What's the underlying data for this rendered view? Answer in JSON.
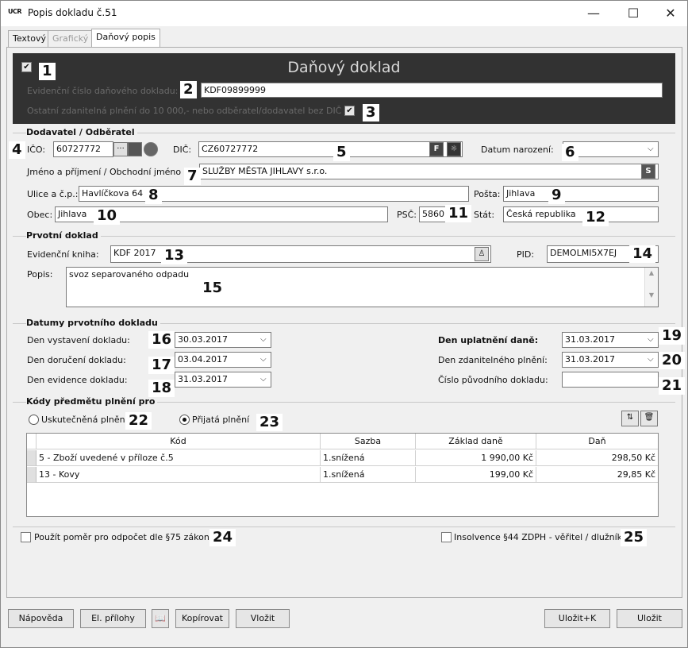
{
  "window": {
    "icon_text": "UCR",
    "title": "Popis dokladu č.51",
    "min": "—",
    "max": "☐",
    "close": "✕"
  },
  "tabs": [
    "Textový",
    "Grafický",
    "Daňový popis"
  ],
  "header": {
    "title": "Daňový doklad",
    "evid_label": "Evidenční číslo daňového dokladu:",
    "evid_value": "KDF09899999",
    "other_label": "Ostatní zdanitelná plnění do 10 000,- nebo odběratel/dodavatel bez DIČ",
    "check1": "✔",
    "check3": "✔"
  },
  "supplier": {
    "section": "Dodavatel / Odběratel",
    "ico_label": "IČO:",
    "ico_value": "60727772",
    "dic_label": "DIČ:",
    "dic_value": "CZ60727772",
    "birth_label": "Datum narození:",
    "birth_value": "",
    "name_label": "Jméno a příjmení / Obchodní jméno",
    "name_value": "SLUŽBY MĚSTA JIHLAVY s.r.o.",
    "street_label": "Ulice a č.p.:",
    "street_value": "Havlíčkova 64",
    "post_label": "Pošta:",
    "post_value": "Jihlava",
    "city_label": "Obec:",
    "city_value": "Jihlava",
    "psc_label": "PSČ:",
    "psc_value": "58601",
    "state_label": "Stát:",
    "state_value": "Česká republika",
    "dots": "···"
  },
  "primary": {
    "section": "Prvotní doklad",
    "book_label": "Evidenční kniha:",
    "book_value": "KDF 2017",
    "pid_label": "PID:",
    "pid_value": "DEMOLMI5X7EJ",
    "desc_label": "Popis:",
    "desc_value": "svoz separovaného odpadu"
  },
  "dates": {
    "section": "Datumy prvotního dokladu",
    "issue_label": "Den vystavení dokladu:",
    "issue_value": "30.03.2017",
    "delivery_label": "Den doručení dokladu:",
    "delivery_value": "03.04.2017",
    "record_label": "Den evidence dokladu:",
    "record_value": "31.03.2017",
    "tax_label": "Den uplatnění daně:",
    "tax_value": "31.03.2017",
    "taxable_label": "Den zdanitelného plnění:",
    "taxable_value": "31.03.2017",
    "orig_label": "Číslo původního dokladu:",
    "orig_value": ""
  },
  "codes": {
    "section": "Kódy předmětu plnění pro",
    "radio1": "Uskutečněná plnění",
    "radio2": "Přijatá plnění",
    "columns": [
      "Kód",
      "Sazba",
      "Základ daně",
      "Daň"
    ],
    "rows": [
      [
        "5 - Zboží uvedené v příloze č.5",
        "1.snížená",
        "1 990,00 Kč",
        "298,50 Kč"
      ],
      [
        "13 - Kovy",
        "1.snížená",
        "199,00 Kč",
        "29,85 Kč"
      ]
    ]
  },
  "bottom": {
    "ratio_label": "Použít poměr pro odpočet dle §75 zákona",
    "insolv_label": "Insolvence §44 ZDPH - věřitel / dlužník"
  },
  "buttons": {
    "help": "Nápověda",
    "attach": "El. přílohy",
    "copy": "Kopírovat",
    "paste": "Vložit",
    "save_k": "Uložit+K",
    "save": "Uložit"
  },
  "markers": [
    "1",
    "2",
    "3",
    "4",
    "5",
    "6",
    "7",
    "8",
    "9",
    "10",
    "11",
    "12",
    "13",
    "14",
    "15",
    "16",
    "17",
    "18",
    "19",
    "20",
    "21",
    "22",
    "23",
    "24",
    "25"
  ]
}
